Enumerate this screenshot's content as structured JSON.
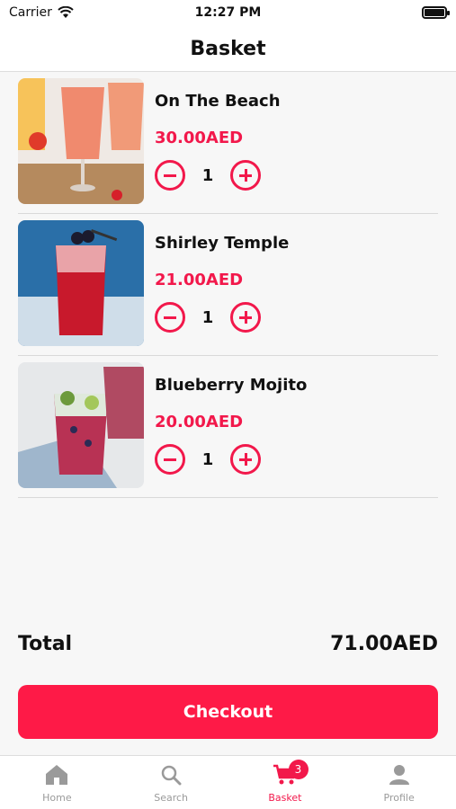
{
  "status_bar": {
    "carrier": "Carrier",
    "time": "12:27 PM"
  },
  "header": {
    "title": "Basket"
  },
  "items": [
    {
      "name": "On The Beach",
      "price": "30.00AED",
      "quantity": "1",
      "image": "cocktail-on-the-beach"
    },
    {
      "name": "Shirley Temple",
      "price": "21.00AED",
      "quantity": "1",
      "image": "cocktail-shirley-temple"
    },
    {
      "name": "Blueberry Mojito",
      "price": "20.00AED",
      "quantity": "1",
      "image": "cocktail-blueberry-mojito"
    }
  ],
  "summary": {
    "total_label": "Total",
    "total_value": "71.00AED"
  },
  "checkout": {
    "label": "Checkout"
  },
  "tabs": [
    {
      "label": "Home",
      "icon": "home-icon"
    },
    {
      "label": "Search",
      "icon": "search-icon"
    },
    {
      "label": "Basket",
      "icon": "cart-icon",
      "badge": "3",
      "active": true
    },
    {
      "label": "Profile",
      "icon": "profile-icon"
    }
  ],
  "colors": {
    "accent": "#f2184b",
    "checkout": "#fe1a47",
    "inactive_tab": "#9a9a9a"
  }
}
